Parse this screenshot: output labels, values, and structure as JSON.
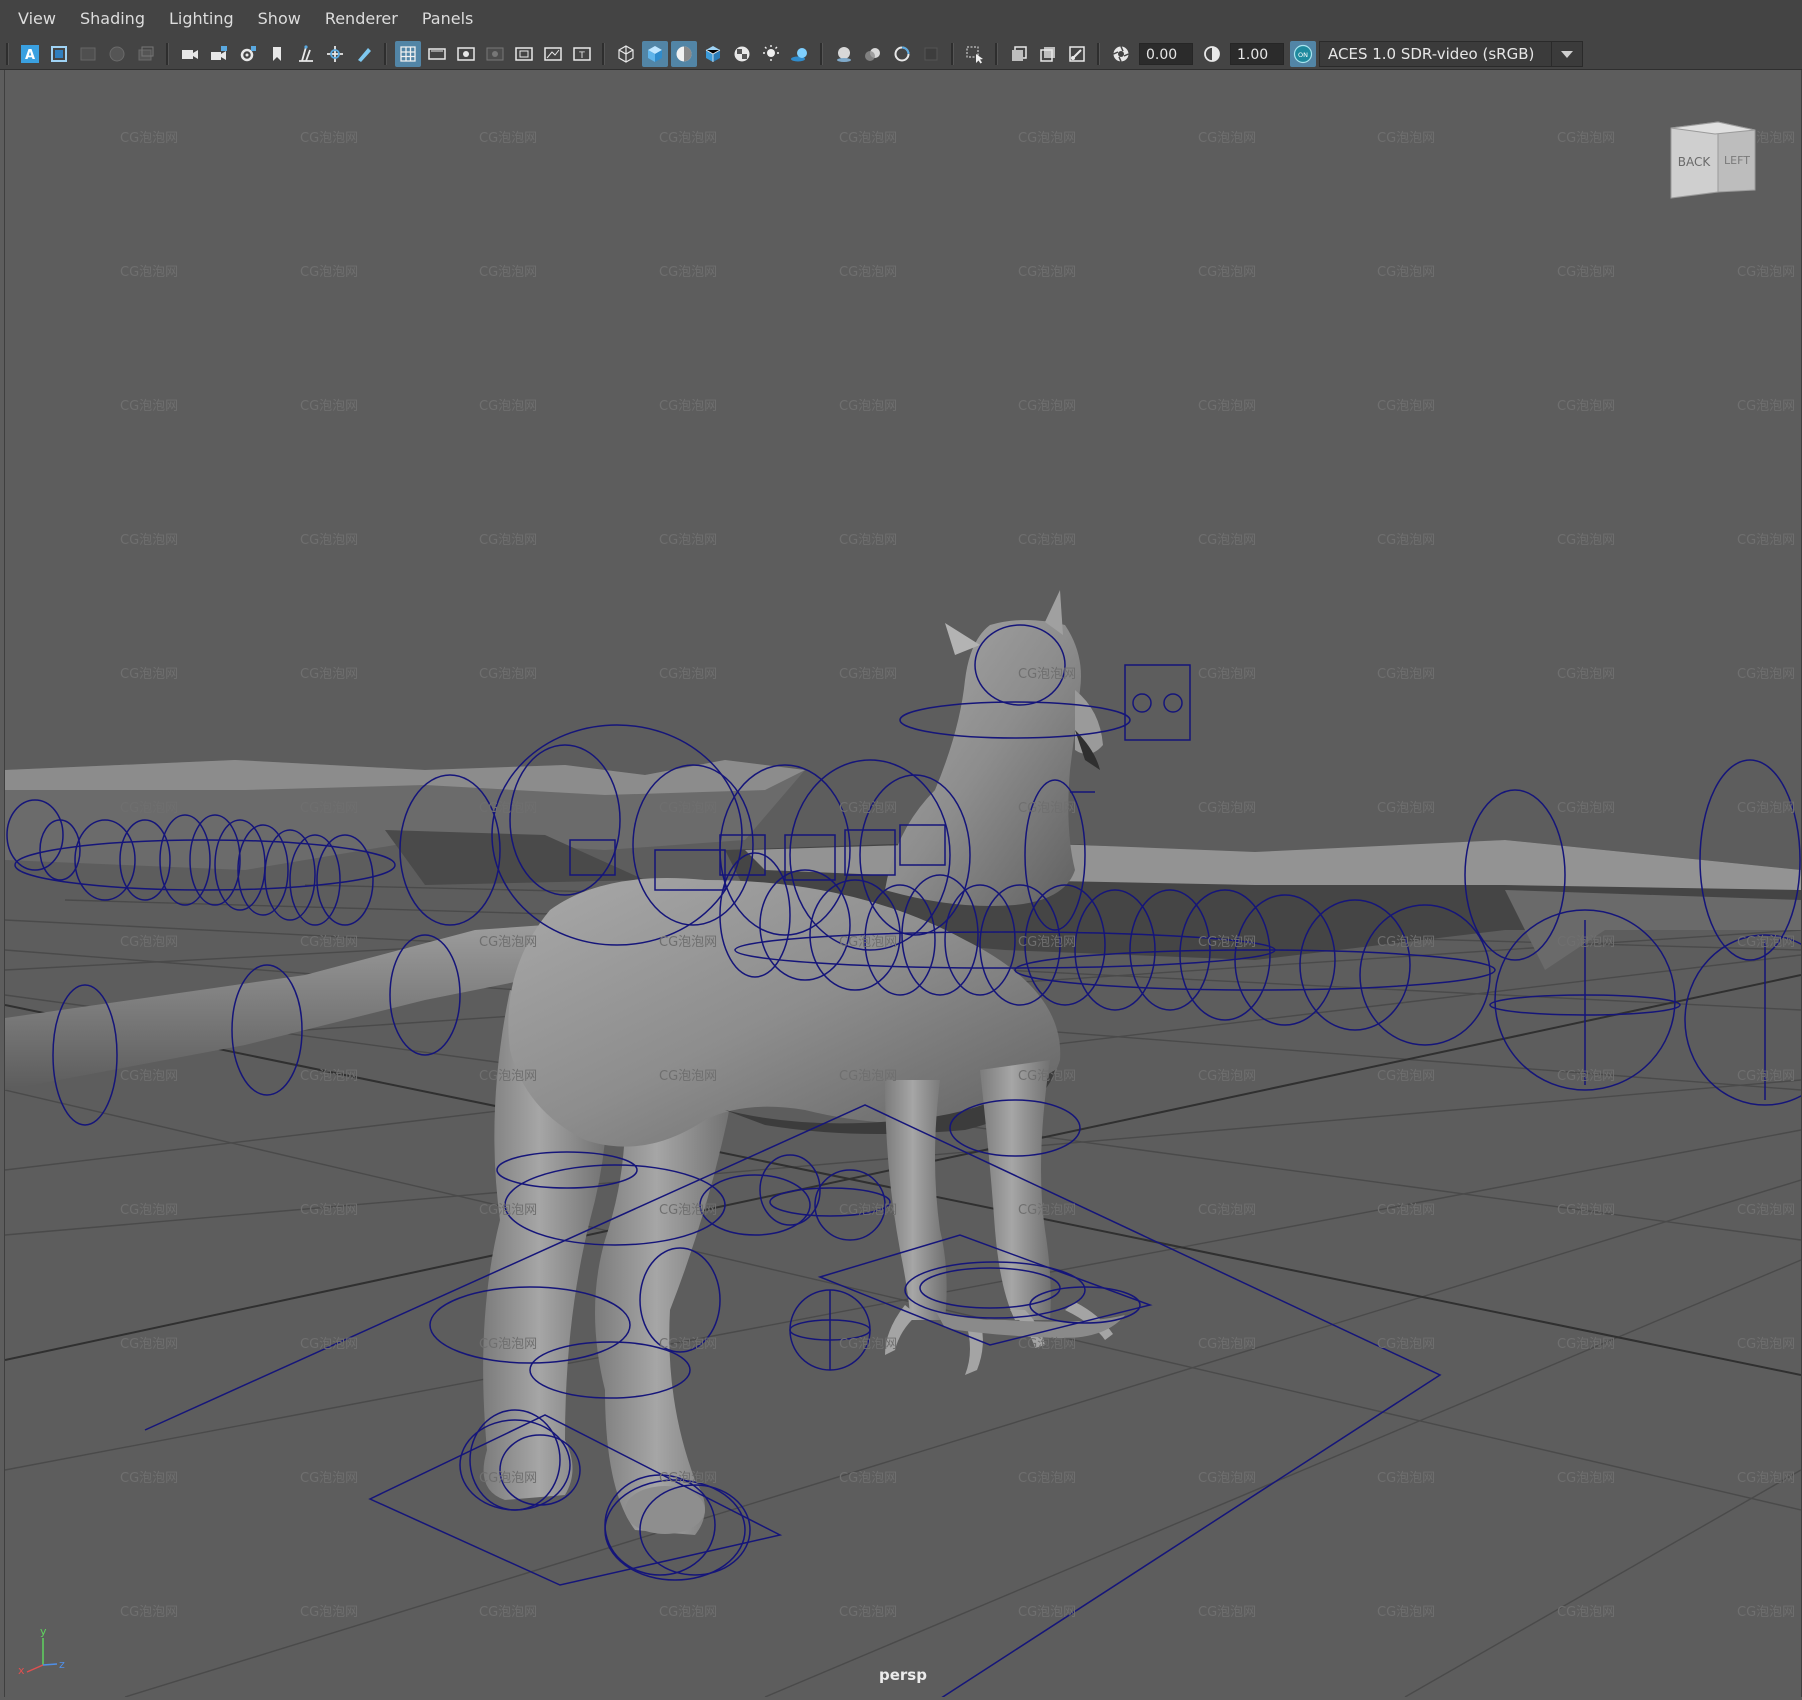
{
  "menubar": {
    "items": [
      "View",
      "Shading",
      "Lighting",
      "Show",
      "Renderer",
      "Panels"
    ]
  },
  "toolbar": {
    "exposure_value": "0.00",
    "gamma_value": "1.00",
    "color_management_badge": "ON",
    "view_transform": "ACES 1.0 SDR-video (sRGB)",
    "accent_color": "#5285a6"
  },
  "viewport": {
    "camera_label": "persp",
    "viewcube": {
      "face_back": "BACK",
      "face_left": "LEFT"
    },
    "axis": {
      "x": "x",
      "y": "y",
      "z": "z"
    },
    "watermark_text": "CG泡泡网",
    "control_curve_color": "#15157a"
  }
}
